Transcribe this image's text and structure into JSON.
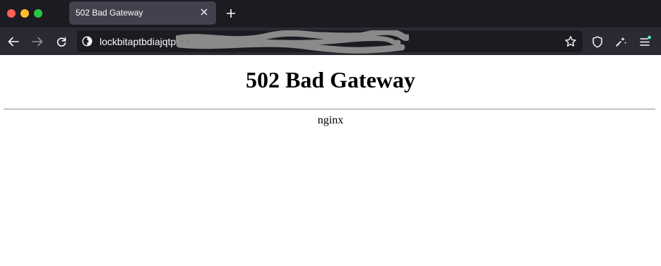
{
  "tab": {
    "title": "502 Bad Gateway"
  },
  "urlbar": {
    "url": "lockbitaptbdiajqtplck"
  },
  "page": {
    "heading": "502 Bad Gateway",
    "server": "nginx"
  },
  "icons": {
    "window_controls": [
      "close-window",
      "minimize-window",
      "zoom-window"
    ],
    "toolbar": [
      "back-arrow",
      "forward-arrow",
      "reload",
      "site-info",
      "bookmark-star",
      "shield",
      "extensions-brush",
      "app-menu"
    ]
  },
  "colors": {
    "titlebar": "#1c1b22",
    "navbar": "#2b2a33",
    "urlbar": "#1c1b22",
    "active_tab": "#42414d",
    "traffic_red": "#ff5f57",
    "traffic_yellow": "#febc2e",
    "traffic_green": "#28c840",
    "notification_dot": "#54ffbd"
  }
}
